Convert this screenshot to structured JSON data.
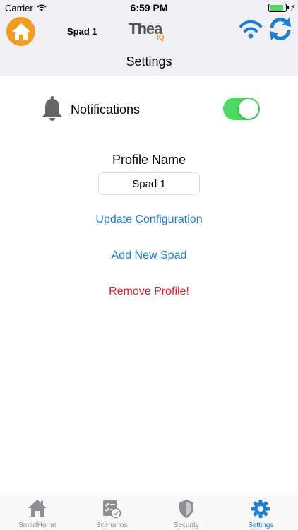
{
  "status_bar": {
    "carrier": "Carrier",
    "time": "6:59 PM",
    "battery_level": 0.85
  },
  "header": {
    "profile_name": "Spad 1",
    "logo_text": "Thea",
    "logo_sub": "IQ",
    "title": "Settings",
    "home_icon": "home-icon",
    "wifi_icon": "wifi-icon",
    "refresh_icon": "refresh-icon"
  },
  "notifications": {
    "label": "Notifications",
    "enabled": true,
    "icon": "bell-icon"
  },
  "profile": {
    "label": "Profile Name",
    "value": "Spad 1"
  },
  "actions": {
    "update": "Update Configuration",
    "add_new": "Add New Spad",
    "remove": "Remove Profile!"
  },
  "tabs": [
    {
      "label": "SmartHome",
      "icon": "house-icon",
      "active": false
    },
    {
      "label": "Scenarios",
      "icon": "scenarios-icon",
      "active": false
    },
    {
      "label": "Security",
      "icon": "shield-icon",
      "active": false
    },
    {
      "label": "Settings",
      "icon": "gear-icon",
      "active": true
    }
  ],
  "colors": {
    "accent": "#1a7fd4",
    "brand_orange": "#f39c22",
    "toggle_on": "#4cd964",
    "danger": "#e0192b",
    "header_bg": "#efeff4"
  }
}
